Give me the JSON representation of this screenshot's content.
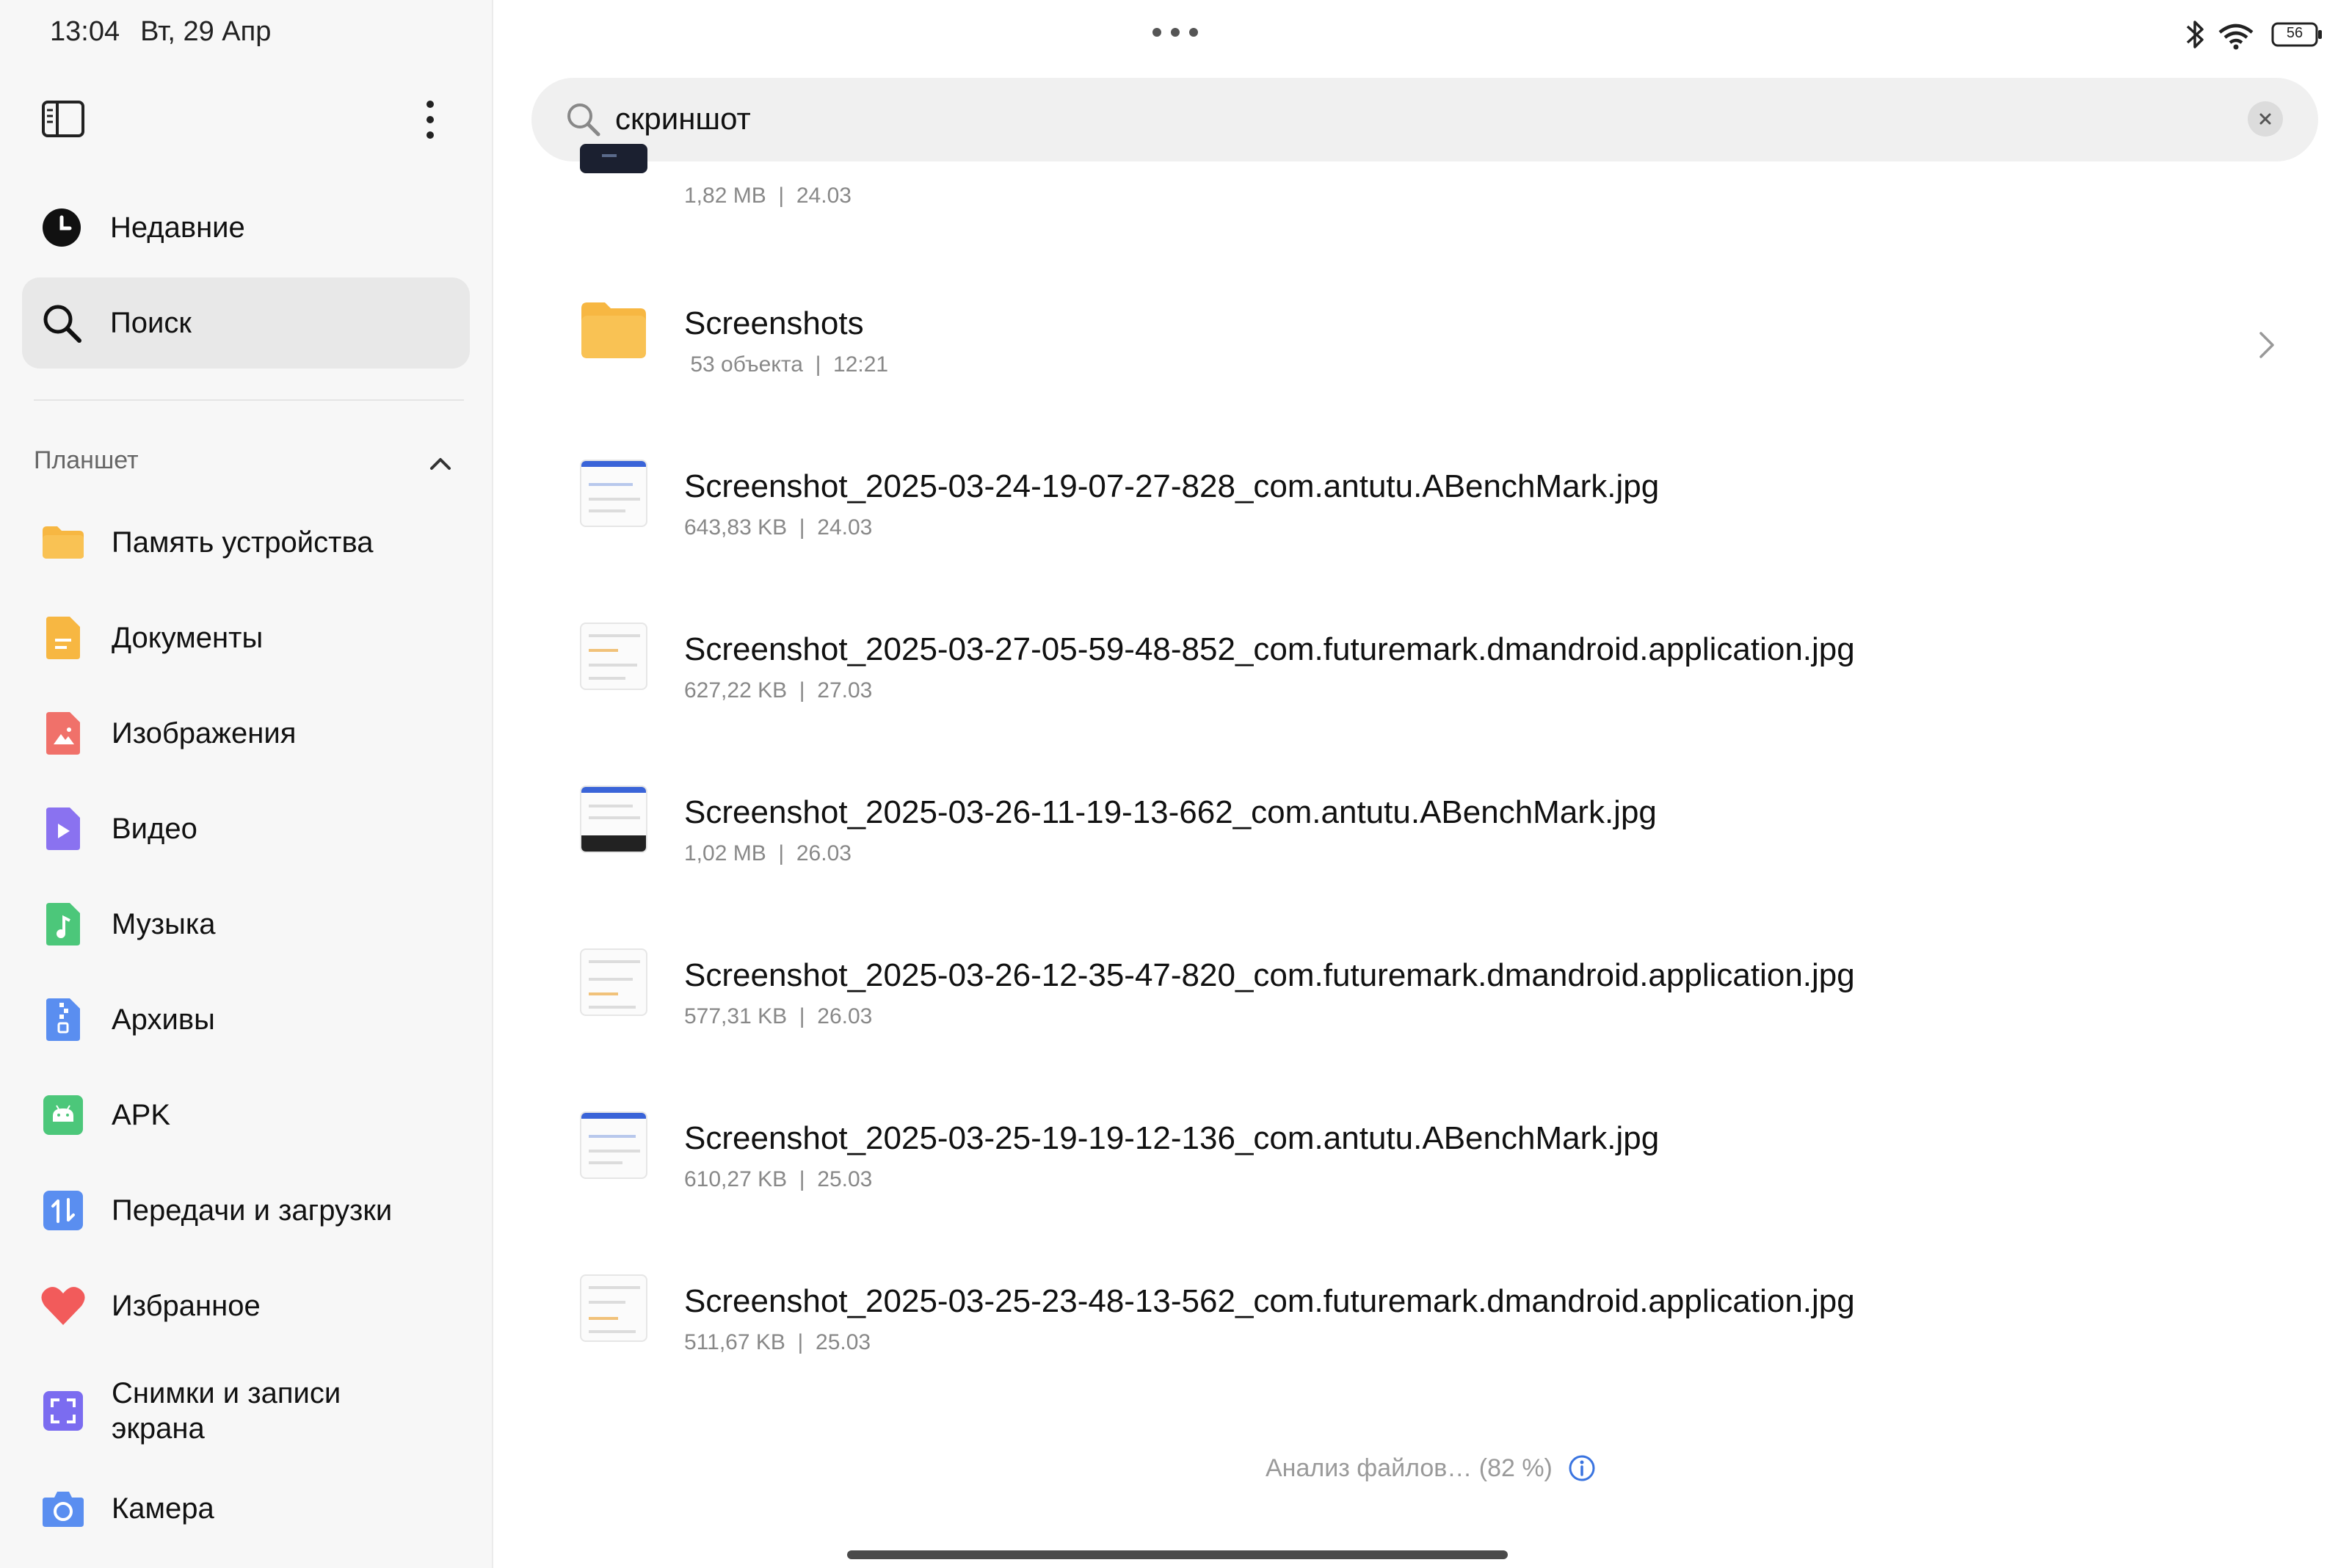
{
  "status_bar": {
    "time": "13:04",
    "date": "Вт, 29 Апр",
    "battery": "56"
  },
  "sidebar": {
    "top_items": [
      {
        "label": "Недавние",
        "icon": "clock-icon"
      },
      {
        "label": "Поиск",
        "icon": "search-icon",
        "active": true
      }
    ],
    "section_title": "Планшет",
    "items": [
      {
        "label": "Память устройства",
        "icon": "folder-icon",
        "color": "#f7b742"
      },
      {
        "label": "Документы",
        "icon": "document-icon",
        "color": "#f7b742"
      },
      {
        "label": "Изображения",
        "icon": "image-icon",
        "color": "#f0716a"
      },
      {
        "label": "Видео",
        "icon": "video-icon",
        "color": "#8a72f0"
      },
      {
        "label": "Музыка",
        "icon": "music-icon",
        "color": "#4cc77a"
      },
      {
        "label": "Архивы",
        "icon": "archive-icon",
        "color": "#5a8ef0"
      },
      {
        "label": "APK",
        "icon": "android-icon",
        "color": "#4cc77a"
      },
      {
        "label": "Передачи и загрузки",
        "icon": "transfer-icon",
        "color": "#5a8ef0"
      },
      {
        "label": "Избранное",
        "icon": "heart-icon",
        "color": "#f25b5b"
      },
      {
        "label": "Снимки и записи экрана",
        "icon": "screenshot-icon",
        "color": "#7b6cf0"
      },
      {
        "label": "Камера",
        "icon": "camera-icon",
        "color": "#5a8ef0"
      }
    ]
  },
  "search": {
    "query": "скриншот"
  },
  "results": [
    {
      "type": "image",
      "name": "",
      "size": "1,82 MB",
      "date": "24.03",
      "thumb": "dark"
    },
    {
      "type": "folder",
      "name": "Screenshots",
      "size": "53 объекта",
      "date": "12:21"
    },
    {
      "type": "image",
      "name": "Screenshot_2025-03-24-19-07-27-828_com.antutu.ABenchMark.jpg",
      "size": "643,83 KB",
      "date": "24.03",
      "thumb": "blue"
    },
    {
      "type": "image",
      "name": "Screenshot_2025-03-27-05-59-48-852_com.futuremark.dmandroid.application.jpg",
      "size": "627,22 KB",
      "date": "27.03",
      "thumb": "plain"
    },
    {
      "type": "image",
      "name": "Screenshot_2025-03-26-11-19-13-662_com.antutu.ABenchMark.jpg",
      "size": "1,02 MB",
      "date": "26.03",
      "thumb": "blue-dark"
    },
    {
      "type": "image",
      "name": "Screenshot_2025-03-26-12-35-47-820_com.futuremark.dmandroid.application.jpg",
      "size": "577,31 KB",
      "date": "26.03",
      "thumb": "plain"
    },
    {
      "type": "image",
      "name": "Screenshot_2025-03-25-19-19-12-136_com.antutu.ABenchMark.jpg",
      "size": "610,27 KB",
      "date": "25.03",
      "thumb": "blue"
    },
    {
      "type": "image",
      "name": "Screenshot_2025-03-25-23-48-13-562_com.futuremark.dmandroid.application.jpg",
      "size": "511,67 KB",
      "date": "25.03",
      "thumb": "plain"
    }
  ],
  "footer": {
    "status": "Анализ файлов… (82 %)"
  }
}
